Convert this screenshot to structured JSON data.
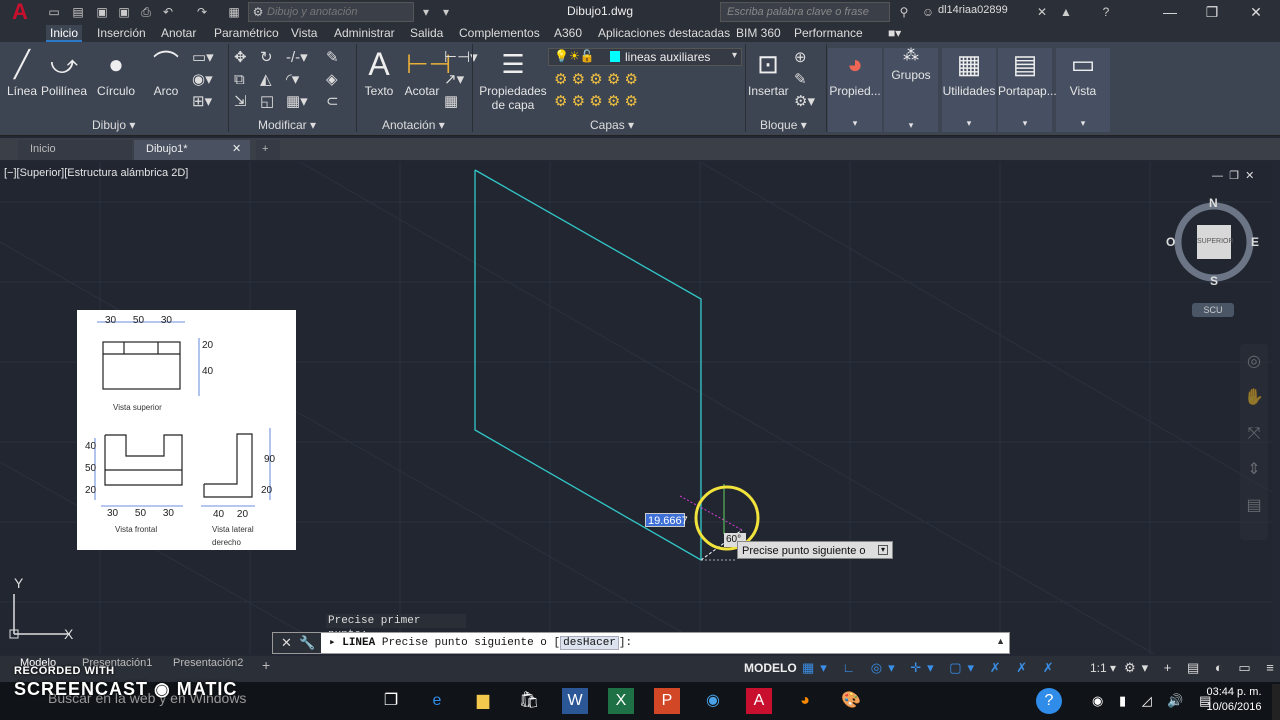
{
  "app": {
    "title": "Dibujo1.dwg",
    "workspace_placeholder": "Dibujo y anotación",
    "keyword_placeholder": "Escriba palabra clave o frase",
    "user": "dl14riaa02899"
  },
  "ribbon_tabs": [
    "Inicio",
    "Inserción",
    "Anotar",
    "Paramétrico",
    "Vista",
    "Administrar",
    "Salida",
    "Complementos",
    "A360",
    "Aplicaciones destacadas",
    "BIM 360",
    "Performance"
  ],
  "ribbon": {
    "draw": {
      "linea": "Línea",
      "polilinea": "Polilínea",
      "circulo": "Círculo",
      "arco": "Arco",
      "panel": "Dibujo"
    },
    "modify": {
      "panel": "Modificar"
    },
    "annotation": {
      "texto": "Texto",
      "acotar": "Acotar",
      "panel": "Anotación"
    },
    "layers": {
      "props": "Propiedades de capa",
      "current_layer": "lineas auxiliares",
      "panel": "Capas"
    },
    "block": {
      "insertar": "Insertar",
      "panel": "Bloque"
    },
    "other": {
      "propiedades": "Propied...",
      "grupos": "Grupos",
      "utilidades": "Utilidades",
      "portapapeles": "Portapap...",
      "vista": "Vista"
    }
  },
  "file_tabs": {
    "start": "Inicio",
    "drawing": "Dibujo1*"
  },
  "viewport": {
    "label": "[−][Superior][Estructura alámbrica 2D]",
    "cube_label": "SUPERIOR",
    "compass": {
      "n": "N",
      "s": "S",
      "e": "E",
      "w": "O"
    },
    "ucs": "SCU"
  },
  "reference": {
    "dims_top": [
      "30",
      "50",
      "30"
    ],
    "dims_right_top": [
      "20",
      "40"
    ],
    "caption_top": "Vista superior",
    "dims_left": [
      "40",
      "50",
      "20"
    ],
    "dims_bottom_front": [
      "30",
      "50",
      "30"
    ],
    "caption_front": "Vista frontal",
    "dims_side_right": [
      "90",
      "20"
    ],
    "dims_bottom_side": [
      "40",
      "20"
    ],
    "caption_side": "Vista lateral derecho"
  },
  "drawing": {
    "length_value": "19.6667",
    "angle_value": "60°",
    "tooltip": "Precise punto siguiente o"
  },
  "command": {
    "history": "Precise primer punto:",
    "name": "LINEA",
    "prompt": "Precise punto siguiente o [",
    "option": "desHacer",
    "suffix": "]:"
  },
  "layout_tabs": [
    "Modelo",
    "Presentación1",
    "Presentación2"
  ],
  "status": {
    "mode": "MODELO",
    "scale": "1:1"
  },
  "taskbar": {
    "search": "Buscar en la web y en Windows",
    "time": "03:44 p. m.",
    "date": "10/06/2016"
  },
  "watermark": {
    "line1": "RECORDED WITH",
    "line2": "SCREENCAST ◉ MATIC"
  },
  "colors": {
    "accent": "#2d79c7",
    "cad_line": "#32c8c8",
    "viewport_bg": "#212631",
    "ribbon_bg": "#3d4452"
  }
}
